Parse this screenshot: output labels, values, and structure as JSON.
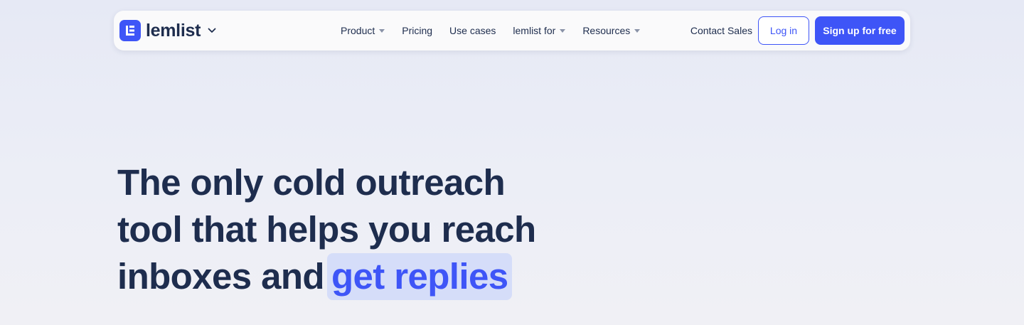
{
  "brand": {
    "name": "lemlist",
    "logo_icon": "lemlist-logo-icon",
    "dropdown_icon": "chevron-down-icon",
    "color": "#3e55f7"
  },
  "nav": {
    "items": [
      {
        "label": "Product",
        "has_dropdown": true
      },
      {
        "label": "Pricing",
        "has_dropdown": false
      },
      {
        "label": "Use cases",
        "has_dropdown": false
      },
      {
        "label": "lemlist for",
        "has_dropdown": true
      },
      {
        "label": "Resources",
        "has_dropdown": true
      }
    ],
    "contact_label": "Contact Sales",
    "login_label": "Log in",
    "signup_label": "Sign up for free"
  },
  "hero": {
    "line1": "The only cold outreach",
    "line2": "tool that helps you reach",
    "line3_prefix": "inboxes and",
    "line3_highlight": "get replies"
  },
  "colors": {
    "text": "#1e2d4e",
    "accent": "#3e55f7",
    "highlight_bg": "#d5ddf9"
  }
}
